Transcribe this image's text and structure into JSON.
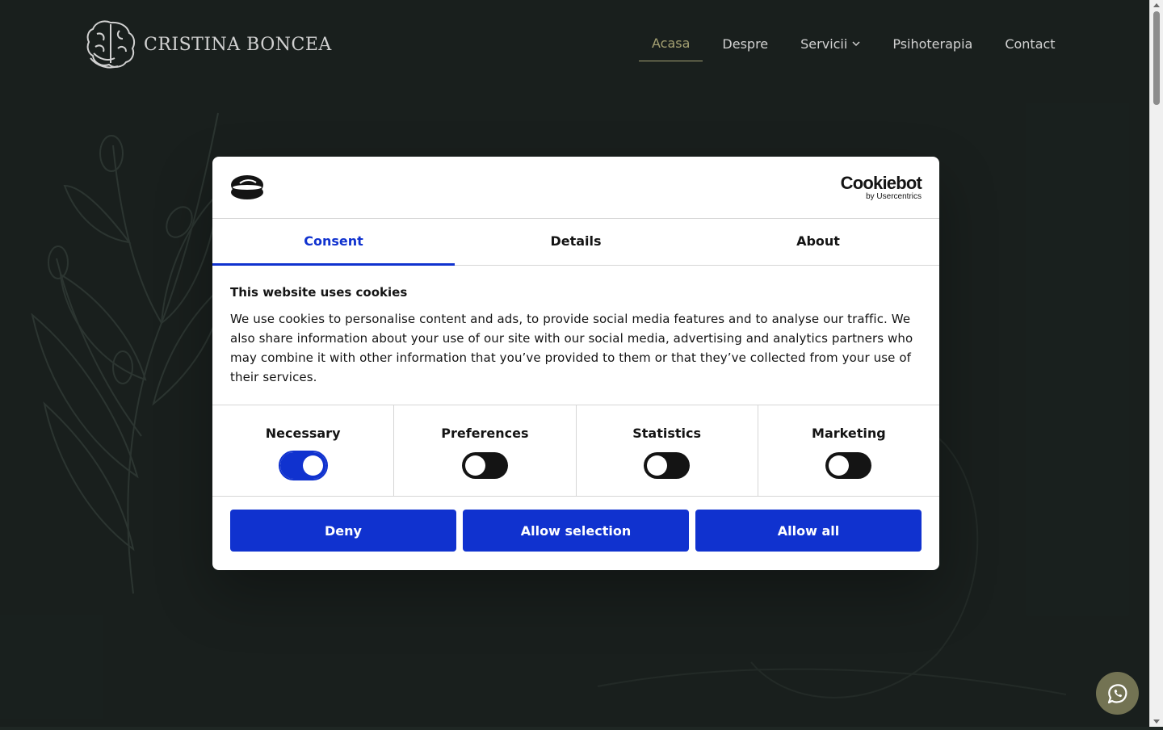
{
  "site": {
    "logo_text": "CRISTINA BONCEA",
    "nav": [
      {
        "label": "Acasa",
        "active": true
      },
      {
        "label": "Despre",
        "active": false
      },
      {
        "label": "Servicii",
        "active": false,
        "has_dropdown": true
      },
      {
        "label": "Psihoterapia",
        "active": false
      },
      {
        "label": "Contact",
        "active": false
      }
    ],
    "accent_color": "#c9c48b",
    "background_color": "#1f2724"
  },
  "cookie_dialog": {
    "brand_name": "Cookiebot",
    "brand_sub": "by Usercentrics",
    "tabs": [
      {
        "label": "Consent",
        "active": true
      },
      {
        "label": "Details",
        "active": false
      },
      {
        "label": "About",
        "active": false
      }
    ],
    "title": "This website uses cookies",
    "text": "We use cookies to personalise content and ads, to provide social media features and to analyse our traffic. We also share information about your use of our site with our social media, advertising and analytics partners who may combine it with other information that you’ve provided to them or that they’ve collected from your use of their services.",
    "toggles": [
      {
        "label": "Necessary",
        "on": true
      },
      {
        "label": "Preferences",
        "on": false
      },
      {
        "label": "Statistics",
        "on": false
      },
      {
        "label": "Marketing",
        "on": false
      }
    ],
    "buttons": {
      "deny": "Deny",
      "allow_selection": "Allow selection",
      "allow_all": "Allow all"
    },
    "accent_color": "#1032cf"
  },
  "whatsapp": {
    "icon": "whatsapp-icon"
  }
}
